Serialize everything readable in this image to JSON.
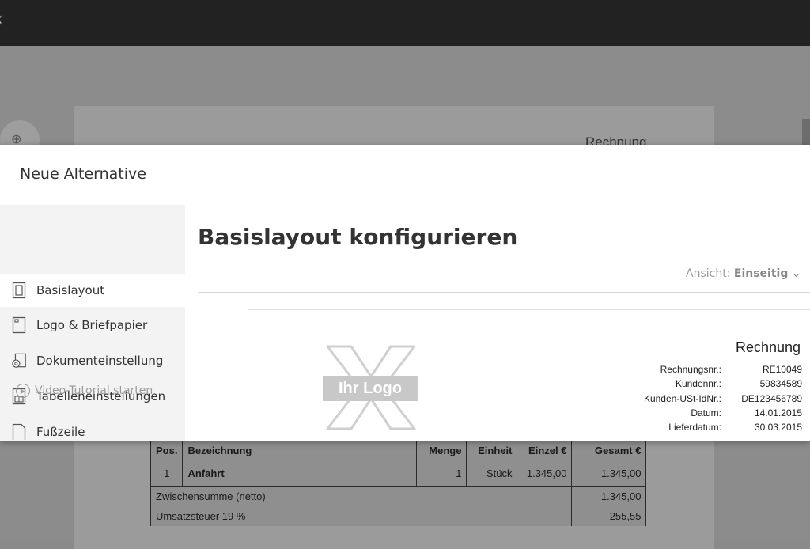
{
  "modal": {
    "title": "Neue Alternative",
    "sidebar": {
      "items": [
        {
          "label": "Basislayout",
          "icon": "page-layout-icon",
          "active": true
        },
        {
          "label": "Logo & Briefpapier",
          "icon": "letterhead-icon",
          "active": false
        },
        {
          "label": "Dokumenteinstellung",
          "icon": "document-settings-icon",
          "active": false
        },
        {
          "label": "Tabelleneinstellungen",
          "icon": "table-settings-icon",
          "active": false
        },
        {
          "label": "Fußzeile",
          "icon": "footer-icon",
          "active": false
        }
      ],
      "video_tutorial": "Video-Tutorial starten"
    },
    "main": {
      "title": "Basislayout konfigurieren",
      "view_label": "Ansicht:",
      "view_value": "Einseitig",
      "preview": {
        "logo_placeholder": "Ihr Logo",
        "doc_title": "Rechnung",
        "meta": [
          {
            "label": "Rechnungsnr.:",
            "value": "RE10049"
          },
          {
            "label": "Kundennr.:",
            "value": "59834589"
          },
          {
            "label": "Kunden-USt-IdNr.:",
            "value": "DE123456789"
          },
          {
            "label": "Datum:",
            "value": "14.01.2015"
          },
          {
            "label": "Lieferdatum:",
            "value": "30.03.2015"
          }
        ]
      }
    }
  },
  "background": {
    "doc_title": "Rechnung",
    "table": {
      "headers": [
        "Pos.",
        "Bezeichnung",
        "Menge",
        "Einheit",
        "Einzel €",
        "Gesamt €"
      ],
      "row": [
        "1",
        "Anfahrt",
        "1",
        "Stück",
        "1.345,00",
        "1.345,00"
      ],
      "subtotal_label": "Zwischensumme (netto)",
      "subtotal_value": "1.345,00",
      "tax_label": "Umsatzsteuer 19 %",
      "tax_value": "255,55"
    }
  },
  "colors": {
    "overlay": "#8c8c8c",
    "topbar": "#222222",
    "sidebar_bg": "#f3f3f3",
    "text": "#333333"
  }
}
